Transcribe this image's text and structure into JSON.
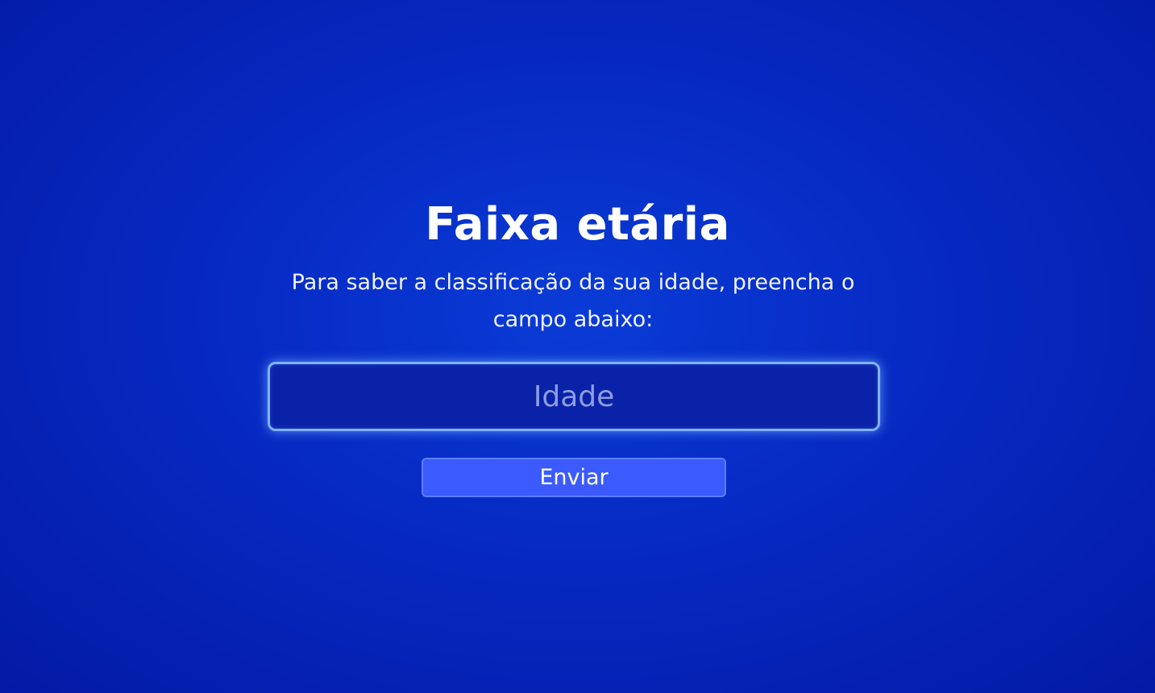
{
  "page": {
    "title": "Faixa etária",
    "subtitle": "Para saber a classificação da sua idade, preencha o campo abaixo:"
  },
  "form": {
    "age_placeholder": "Idade",
    "age_value": "",
    "submit_label": "Enviar"
  },
  "colors": {
    "background": "#0629c2",
    "input_border": "#7fb2ff",
    "button": "#3b5bff",
    "text": "#ffffff"
  }
}
